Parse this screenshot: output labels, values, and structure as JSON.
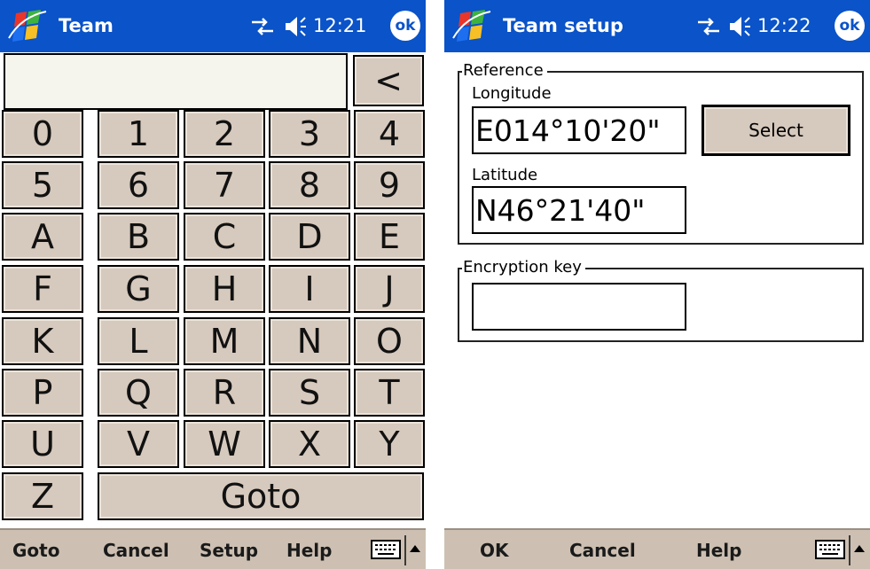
{
  "colors": {
    "titlebar": "#0a53c8",
    "key_face": "#d6c9bd",
    "menubar": "#cdc0b2"
  },
  "left": {
    "title": "Team",
    "clock": "12:21",
    "ok_label": "ok",
    "backspace_label": "<",
    "keys": [
      "0",
      "1",
      "2",
      "3",
      "4",
      "5",
      "6",
      "7",
      "8",
      "9",
      "A",
      "B",
      "C",
      "D",
      "E",
      "F",
      "G",
      "H",
      "I",
      "J",
      "K",
      "L",
      "M",
      "N",
      "O",
      "P",
      "Q",
      "R",
      "S",
      "T",
      "U",
      "V",
      "W",
      "X",
      "Y",
      "Z"
    ],
    "goto_key": "Goto",
    "menu": {
      "goto": "Goto",
      "cancel": "Cancel",
      "setup": "Setup",
      "help": "Help"
    },
    "icons": [
      "windows-start-icon",
      "connectivity-icon",
      "volume-icon",
      "keyboard-icon",
      "chevron-up-icon"
    ]
  },
  "right": {
    "title": "Team setup",
    "clock": "12:22",
    "ok_label": "ok",
    "reference_group": "Reference",
    "longitude_label": "Longitude",
    "longitude_value": "E014°10'20\"",
    "latitude_label": "Latitude",
    "latitude_value": "N46°21'40\"",
    "select_button": "Select",
    "encryption_group": "Encryption key",
    "encryption_value": "",
    "menu": {
      "ok": "OK",
      "cancel": "Cancel",
      "help": "Help"
    }
  }
}
